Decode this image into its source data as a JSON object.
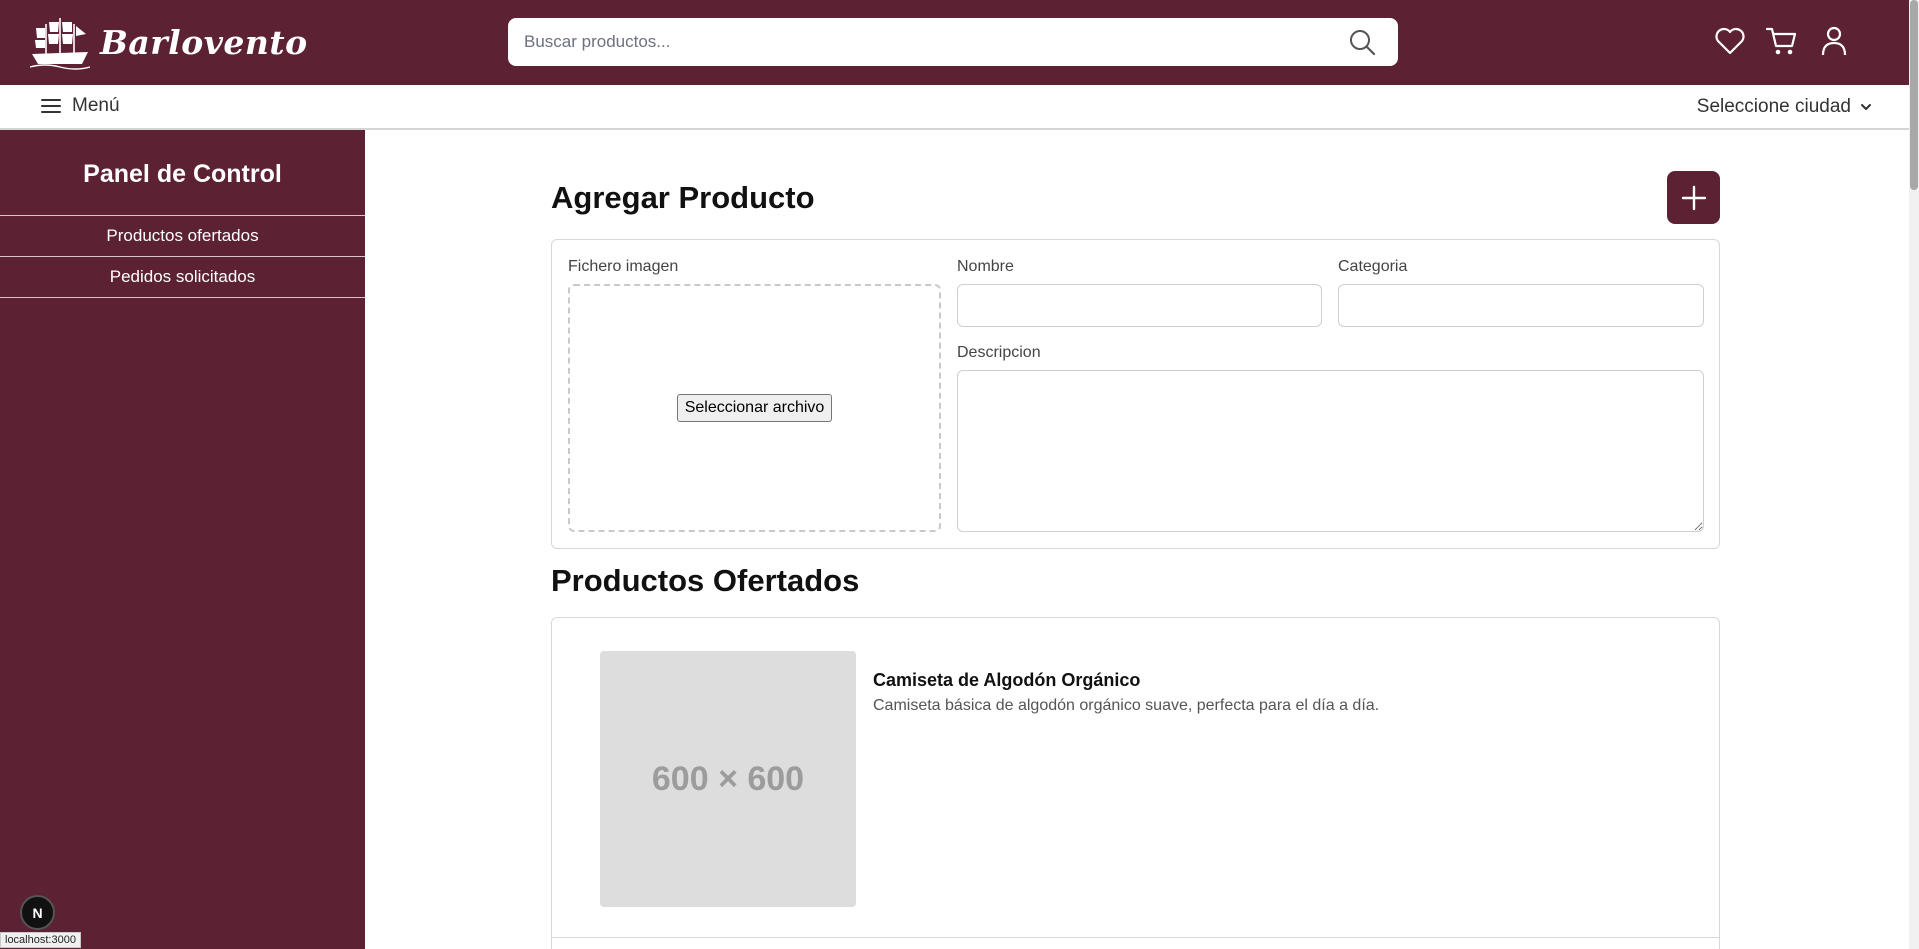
{
  "header": {
    "brand": "Barlovento",
    "search_placeholder": "Buscar productos...",
    "icons": [
      "heart-icon",
      "cart-icon",
      "user-icon"
    ],
    "bg_color": "#5c2234"
  },
  "navbar": {
    "menu_label": "Menú",
    "city_label": "Seleccione ciudad"
  },
  "sidebar": {
    "title": "Panel de Control",
    "items": [
      {
        "label": "Productos ofertados"
      },
      {
        "label": "Pedidos solicitados"
      }
    ]
  },
  "add_product": {
    "title": "Agregar Producto",
    "image_label": "Fichero imagen",
    "file_button": "Seleccionar archivo",
    "name_label": "Nombre",
    "category_label": "Categoria",
    "description_label": "Descripcion"
  },
  "offered_products": {
    "title": "Productos Ofertados",
    "items": [
      {
        "placeholder": "600 × 600",
        "name": "Camiseta de Algodón Orgánico",
        "description": "Camiseta básica de algodón orgánico suave, perfecta para el día a día."
      }
    ]
  },
  "dev_badge": "N",
  "status_url": "localhost:3000"
}
